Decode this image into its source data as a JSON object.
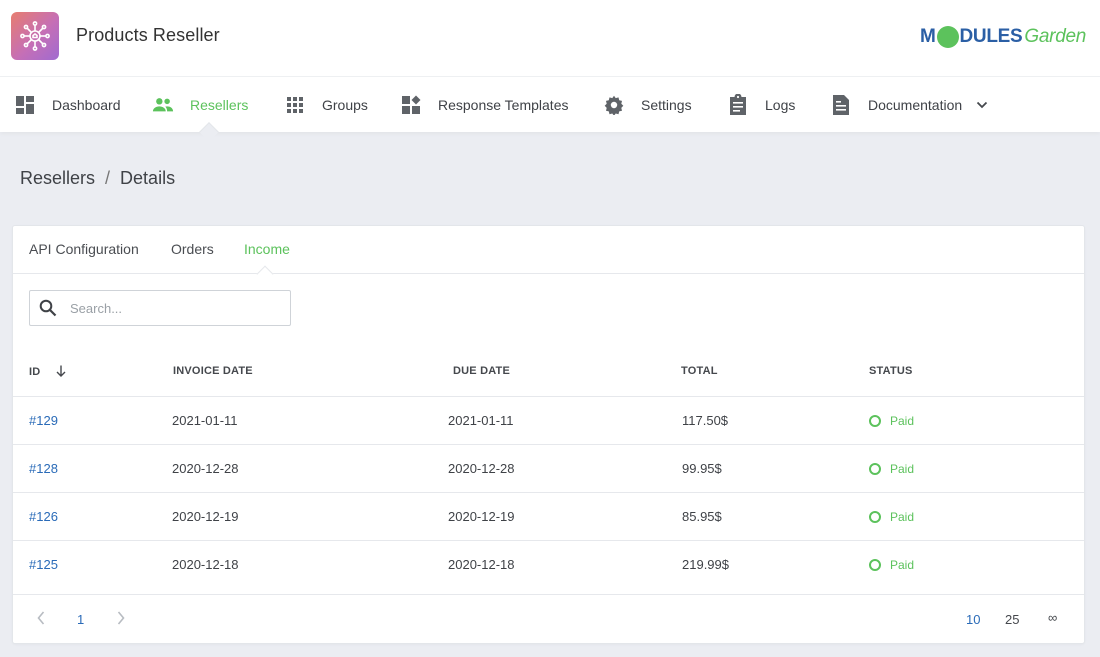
{
  "header": {
    "app_title": "Products Reseller",
    "brand": {
      "part1": "M",
      "part2": "DULES",
      "part3": "Garden"
    }
  },
  "nav": {
    "items": [
      {
        "label": "Dashboard",
        "icon": "dashboard-icon"
      },
      {
        "label": "Resellers",
        "icon": "users-icon",
        "active": true
      },
      {
        "label": "Groups",
        "icon": "grid-icon"
      },
      {
        "label": "Response Templates",
        "icon": "widgets-icon"
      },
      {
        "label": "Settings",
        "icon": "gear-icon"
      },
      {
        "label": "Logs",
        "icon": "clipboard-icon"
      },
      {
        "label": "Documentation",
        "icon": "document-icon"
      }
    ]
  },
  "breadcrumb": {
    "parent": "Resellers",
    "separator": "/",
    "current": "Details"
  },
  "tabs": [
    {
      "label": "API Configuration"
    },
    {
      "label": "Orders"
    },
    {
      "label": "Income",
      "active": true
    }
  ],
  "search": {
    "placeholder": "Search...",
    "value": ""
  },
  "table": {
    "columns": [
      "ID",
      "INVOICE DATE",
      "DUE DATE",
      "TOTAL",
      "STATUS"
    ],
    "rows": [
      {
        "id": "#129",
        "invoice_date": "2021-01-11",
        "due_date": "2021-01-11",
        "total": "117.50$",
        "status": "Paid"
      },
      {
        "id": "#128",
        "invoice_date": "2020-12-28",
        "due_date": "2020-12-28",
        "total": "99.95$",
        "status": "Paid"
      },
      {
        "id": "#126",
        "invoice_date": "2020-12-19",
        "due_date": "2020-12-19",
        "total": "85.95$",
        "status": "Paid"
      },
      {
        "id": "#125",
        "invoice_date": "2020-12-18",
        "due_date": "2020-12-18",
        "total": "219.99$",
        "status": "Paid"
      }
    ]
  },
  "pagination": {
    "current_page": "1",
    "page_sizes": [
      "10",
      "25",
      "∞"
    ],
    "selected_page_size": "10"
  },
  "colors": {
    "accent": "#5cc25c",
    "link": "#2a6bb8",
    "brand_blue": "#2b5fa5"
  }
}
